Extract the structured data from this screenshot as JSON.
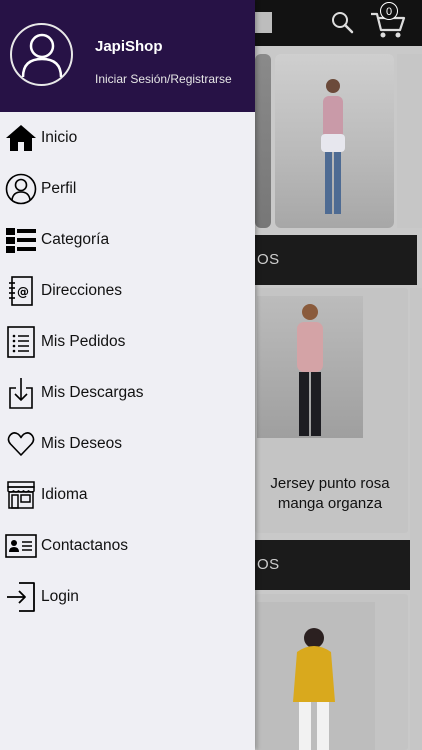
{
  "background": {
    "cart_count": "0",
    "section_bar_1_text": "OS",
    "section_bar_2_text": "OS",
    "product_title": "Jersey punto rosa manga organza"
  },
  "drawer": {
    "shop_name": "JapiShop",
    "login_text": "Iniciar Sesión/Registrarse",
    "header_color": "#271246",
    "items": [
      {
        "label": "Inicio",
        "icon": "home-icon"
      },
      {
        "label": "Perfil",
        "icon": "profile-icon"
      },
      {
        "label": "Categoría",
        "icon": "category-list-icon"
      },
      {
        "label": "Direcciones",
        "icon": "address-book-icon"
      },
      {
        "label": "Mis Pedidos",
        "icon": "orders-list-icon"
      },
      {
        "label": "Mis Descargas",
        "icon": "download-icon"
      },
      {
        "label": "Mis Deseos",
        "icon": "heart-icon"
      },
      {
        "label": "Idioma",
        "icon": "store-icon"
      },
      {
        "label": "Contactanos",
        "icon": "contact-card-icon"
      },
      {
        "label": "Login",
        "icon": "login-icon"
      }
    ]
  }
}
